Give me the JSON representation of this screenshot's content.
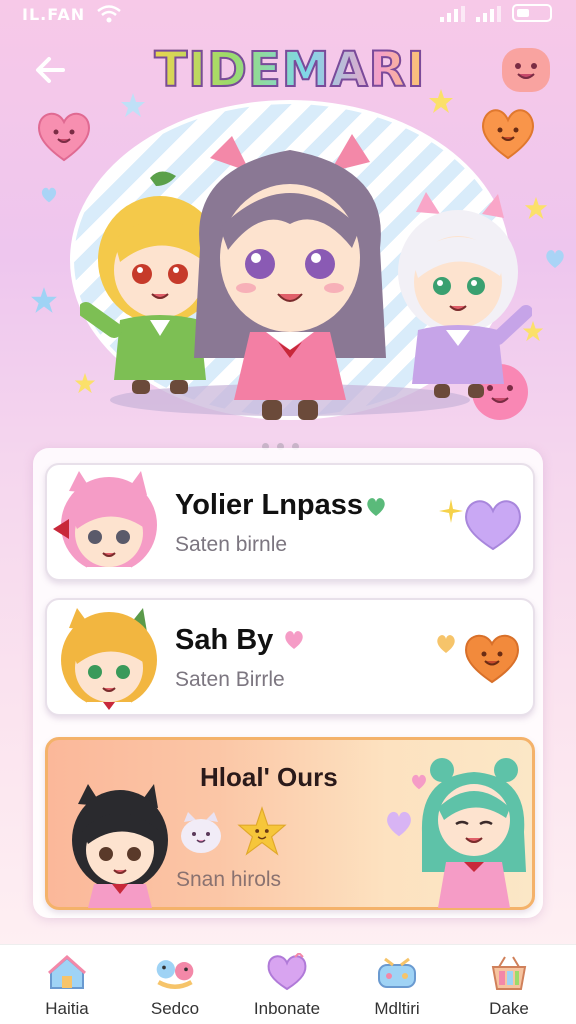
{
  "status_bar": {
    "carrier": "IL.FAN"
  },
  "header": {
    "title": "TIDEMARI",
    "back_icon": "arrow-left-icon"
  },
  "hero": {
    "carousel_pages": 3,
    "active_page": 1
  },
  "list": [
    {
      "title": "Yolier Lnpass",
      "subtitle": "Saten birnle",
      "title_icon": "heart-icon",
      "action_icon": "heart-icon",
      "action_color": "#c9a8f4"
    },
    {
      "title": "Sah By",
      "subtitle": "Saten Birrle",
      "title_icon": "heart-icon",
      "action_icon": "smiley-heart-icon",
      "action_color": "#f28a3c"
    },
    {
      "title": "Hloal' Ours",
      "subtitle": "Snan hirols",
      "featured": true
    }
  ],
  "bottom_nav": [
    {
      "label": "Haitia",
      "icon": "home-icon"
    },
    {
      "label": "Sedco",
      "icon": "game-icon"
    },
    {
      "label": "Inbonate",
      "icon": "heart-chat-icon"
    },
    {
      "label": "Mdltiri",
      "icon": "gamepad-icon"
    },
    {
      "label": "Dake",
      "icon": "basket-icon"
    }
  ],
  "colors": {
    "accent": "#f4b26a",
    "pink": "#f6a0c8",
    "purple": "#b59ad9"
  }
}
